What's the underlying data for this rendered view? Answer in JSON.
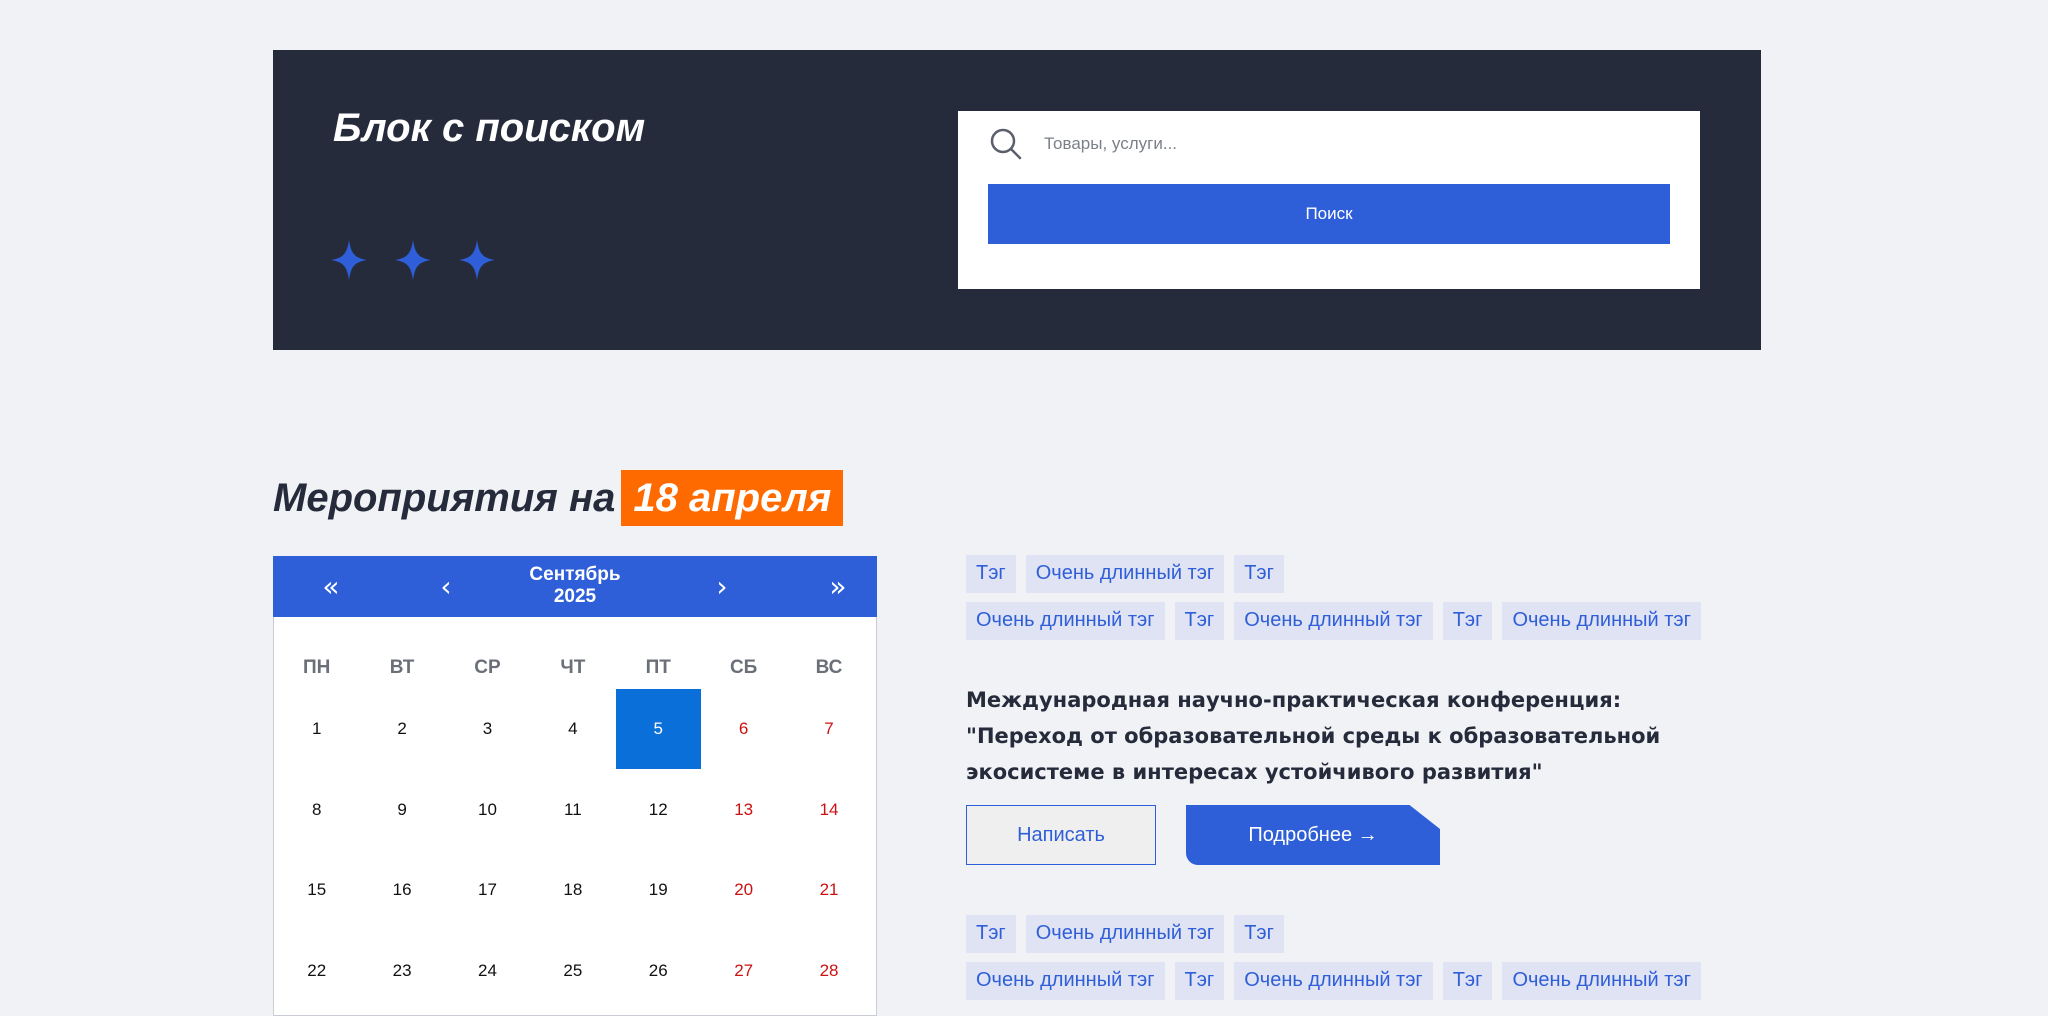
{
  "search_block": {
    "title": "Блок с поиском",
    "placeholder": "Товары, услуги...",
    "button_label": "Поиск",
    "decor_icons": [
      "sparkle-star-icon",
      "sparkle-star-icon",
      "sparkle-star-icon"
    ]
  },
  "events": {
    "heading_prefix": "Мероприятия на",
    "heading_date": "18 апреля"
  },
  "calendar": {
    "month": "Сентябрь",
    "year": "2025",
    "nav": {
      "prev_year": "«",
      "prev_month": "‹",
      "next_month": "›",
      "next_year": "»"
    },
    "weekdays": [
      "ПН",
      "ВТ",
      "СР",
      "ЧТ",
      "ПТ",
      "СБ",
      "ВС"
    ],
    "weeks": [
      [
        "1",
        "2",
        "3",
        "4",
        "5",
        "6",
        "7"
      ],
      [
        "8",
        "9",
        "10",
        "11",
        "12",
        "13",
        "14"
      ],
      [
        "15",
        "16",
        "17",
        "18",
        "19",
        "20",
        "21"
      ],
      [
        "22",
        "23",
        "24",
        "25",
        "26",
        "27",
        "28"
      ]
    ],
    "selected_day": "5"
  },
  "event_list": {
    "tags_top_row1": [
      "Тэг",
      "Очень длинный тэг",
      "Тэг"
    ],
    "tags_top_row2": [
      "Очень длинный тэг",
      "Тэг",
      "Очень длинный тэг",
      "Тэг",
      "Очень длинный тэг"
    ],
    "event_title": "Международная научно-практическая конференция: \"Переход от образовательной среды к образовательной экосистеме в интересах устойчивого развития\"",
    "write_label": "Написать",
    "more_label": "Подробнее →",
    "tags_bottom_row1": [
      "Тэг",
      "Очень длинный тэг",
      "Тэг"
    ],
    "tags_bottom_row2": [
      "Очень длинный тэг",
      "Тэг",
      "Очень длинный тэг",
      "Тэг",
      "Очень длинный тэг"
    ]
  },
  "colors": {
    "banner_bg": "#252b3b",
    "accent_blue": "#2f5fd8",
    "date_orange": "#ff6a00",
    "selected_day": "#0b6fd9",
    "weekend_red": "#cc1111"
  }
}
